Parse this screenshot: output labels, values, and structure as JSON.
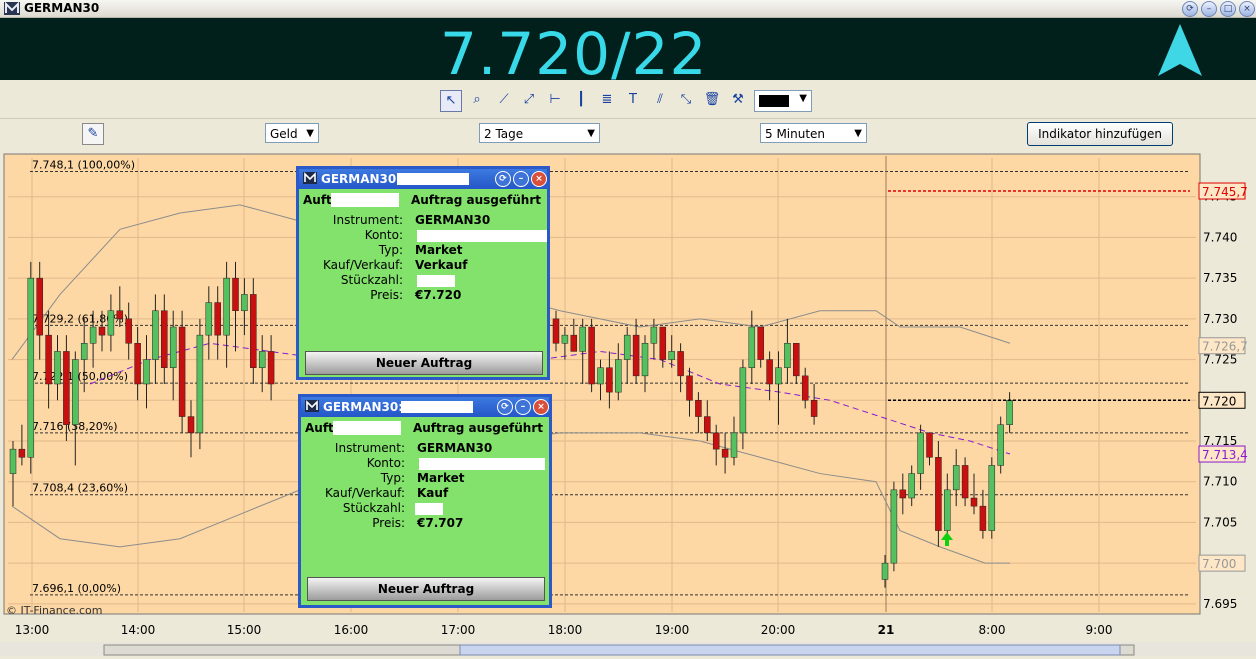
{
  "window": {
    "title": "GERMAN30"
  },
  "quote": {
    "price": "7.720/22",
    "direction_color": "#3fd6e6"
  },
  "toolbar2": {
    "quote_type": "Geld",
    "range": "2 Tage",
    "interval": "5 Minuten",
    "add_indicator": "Indikator hinzufügen"
  },
  "chart_data": {
    "type": "candlestick",
    "title": "",
    "background": "#fdd8a4",
    "ylim": [
      7694,
      7750
    ],
    "y_ticks": [
      "7.695",
      "7.700",
      "7.705",
      "7.710",
      "7.715",
      "7.720",
      "7.725",
      "7.730",
      "7.735",
      "7.740",
      "7.745"
    ],
    "x_ticks": [
      "13:00",
      "14:00",
      "15:00",
      "16:00",
      "17:00",
      "18:00",
      "19:00",
      "20:00",
      "21",
      "8:00",
      "9:00"
    ],
    "fib_levels": [
      {
        "label": "7.748,1 (100,00%)",
        "value": 7748.1
      },
      {
        "label": "7.729,2 (61,80%)",
        "value": 7729.2
      },
      {
        "label": "7.722,1 (50,00%)",
        "value": 7722.1
      },
      {
        "label": "7.716 (38,20%)",
        "value": 7716.0
      },
      {
        "label": "7.708,4 (23,60%)",
        "value": 7708.4
      },
      {
        "label": "7.696,1 (0,00%)",
        "value": 7696.1
      }
    ],
    "price_markers": [
      {
        "label": "7.745,7",
        "value": 7745.7,
        "color": "#e00000"
      },
      {
        "label": "7.726,7",
        "value": 7726.7,
        "color": "#999999"
      },
      {
        "label": "7.720",
        "value": 7720.0,
        "color": "#000000"
      },
      {
        "label": "7.713,4",
        "value": 7713.4,
        "color": "#8a1ad0"
      },
      {
        "label": "7.700",
        "value": 7700.0,
        "color": "#999999"
      }
    ],
    "watermark": "© IT-Finance.com",
    "up_color": "#55c060",
    "down_color": "#c81010",
    "candles": [
      [
        7711,
        7715,
        7707,
        7714
      ],
      [
        7714,
        7717,
        7712,
        7713
      ],
      [
        7713,
        7737,
        7711,
        7735
      ],
      [
        7735,
        7737,
        7725,
        7728
      ],
      [
        7728,
        7731,
        7719,
        7722
      ],
      [
        7722,
        7728,
        7720,
        7726
      ],
      [
        7726,
        7728,
        7715,
        7717
      ],
      [
        7717,
        7726,
        7712,
        7725
      ],
      [
        7725,
        7730,
        7721,
        7727
      ],
      [
        7727,
        7731,
        7724,
        7729
      ],
      [
        7729,
        7731,
        7726,
        7728
      ],
      [
        7728,
        7733,
        7726,
        7731
      ],
      [
        7731,
        7734,
        7729,
        7730
      ],
      [
        7730,
        7732,
        7725,
        7727
      ],
      [
        7727,
        7729,
        7720,
        7722
      ],
      [
        7722,
        7728,
        7719,
        7725
      ],
      [
        7725,
        7733,
        7722,
        7731
      ],
      [
        7731,
        7733,
        7722,
        7724
      ],
      [
        7724,
        7731,
        7720,
        7729
      ],
      [
        7729,
        7731,
        7716,
        7718
      ],
      [
        7718,
        7720,
        7713,
        7716
      ],
      [
        7716,
        7730,
        7714,
        7728
      ],
      [
        7728,
        7734,
        7725,
        7732
      ],
      [
        7732,
        7734,
        7725,
        7728
      ],
      [
        7728,
        7737,
        7724,
        7735
      ],
      [
        7735,
        7737,
        7726,
        7731
      ],
      [
        7731,
        7735,
        7728,
        7733
      ],
      [
        7733,
        7735,
        7722,
        7724
      ],
      [
        7724,
        7728,
        7721,
        7726
      ],
      [
        7726,
        7728,
        7720,
        7722
      ]
    ],
    "candles2": [
      [
        7730,
        7731,
        7726,
        7727
      ],
      [
        7727,
        7729,
        7725,
        7728
      ],
      [
        7728,
        7730,
        7726,
        7726
      ],
      [
        7726,
        7730,
        7722,
        7729
      ],
      [
        7729,
        7730,
        7721,
        7722
      ],
      [
        7722,
        7725,
        7720,
        7724
      ],
      [
        7724,
        7726,
        7719,
        7721
      ],
      [
        7721,
        7727,
        7720,
        7725
      ],
      [
        7725,
        7729,
        7722,
        7728
      ],
      [
        7728,
        7730,
        7722,
        7723
      ],
      [
        7723,
        7728,
        7721,
        7727
      ],
      [
        7727,
        7730,
        7725,
        7729
      ],
      [
        7729,
        7729,
        7724,
        7725
      ],
      [
        7725,
        7728,
        7724,
        7726
      ],
      [
        7726,
        7727,
        7721,
        7723
      ],
      [
        7723,
        7724,
        7718,
        7720
      ],
      [
        7720,
        7721,
        7716,
        7718
      ],
      [
        7718,
        7720,
        7715,
        7716
      ],
      [
        7716,
        7717,
        7712,
        7714
      ],
      [
        7714,
        7716,
        7711,
        7713
      ],
      [
        7713,
        7718,
        7712,
        7716
      ],
      [
        7716,
        7725,
        7714,
        7724
      ],
      [
        7724,
        7731,
        7722,
        7729
      ],
      [
        7729,
        7729,
        7724,
        7725
      ],
      [
        7725,
        7726,
        7720,
        7722
      ],
      [
        7722,
        7726,
        7717,
        7724
      ],
      [
        7724,
        7730,
        7722,
        7727
      ],
      [
        7727,
        7727,
        7722,
        7723
      ],
      [
        7723,
        7724,
        7719,
        7720
      ],
      [
        7720,
        7722,
        7717,
        7718
      ]
    ],
    "candles3": [
      [
        7698,
        7701,
        7697,
        7700
      ],
      [
        7700,
        7710,
        7699,
        7709
      ],
      [
        7709,
        7711,
        7706,
        7708
      ],
      [
        7708,
        7712,
        7707,
        7711
      ],
      [
        7711,
        7717,
        7709,
        7716
      ],
      [
        7716,
        7716,
        7712,
        7713
      ],
      [
        7713,
        7715,
        7702,
        7704
      ],
      [
        7704,
        7711,
        7703,
        7709
      ],
      [
        7709,
        7714,
        7707,
        7712
      ],
      [
        7712,
        7713,
        7707,
        7708
      ],
      [
        7708,
        7711,
        7706,
        7707
      ],
      [
        7707,
        7709,
        7703,
        7704
      ],
      [
        7704,
        7713,
        7703,
        7712
      ],
      [
        7712,
        7718,
        7711,
        7717
      ],
      [
        7717,
        7721,
        7716,
        7720
      ]
    ]
  },
  "dialogs": [
    {
      "caption": "GERMAN30:",
      "head_left": "Auftrag",
      "head_right": "Auftrag ausgeführt",
      "labels": [
        "Instrument:",
        "Konto:",
        "Typ:",
        "Kauf/Verkauf:",
        "Stückzahl:",
        "Preis:"
      ],
      "values": [
        "GERMAN30",
        "",
        "Market",
        "Verkauf",
        "",
        "€7.720"
      ],
      "button": "Neuer Auftrag"
    },
    {
      "caption": "GERMAN30:",
      "head_left": "Auftrag",
      "head_right": "Auftrag ausgeführt",
      "labels": [
        "Instrument:",
        "Konto:",
        "Typ:",
        "Kauf/Verkauf:",
        "Stückzahl:",
        "Preis:"
      ],
      "values": [
        "GERMAN30",
        "",
        "Market",
        "Kauf",
        "",
        "€7.707"
      ],
      "button": "Neuer Auftrag"
    }
  ]
}
